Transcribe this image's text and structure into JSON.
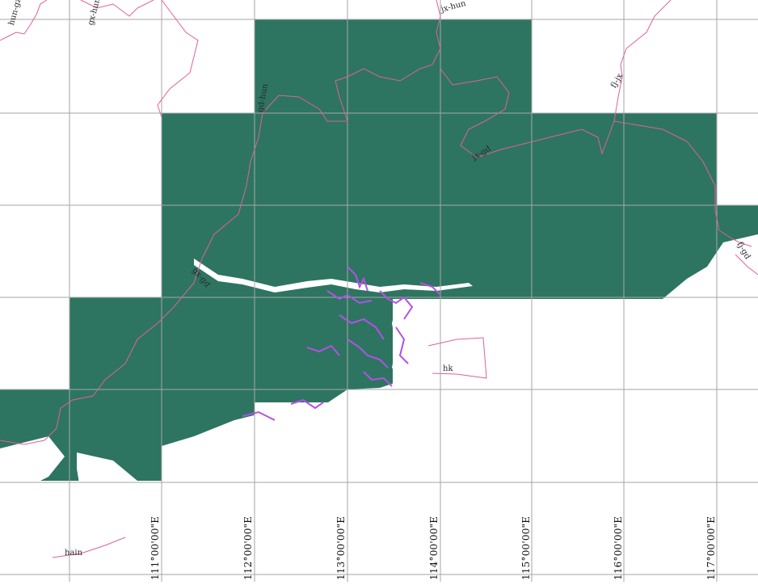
{
  "map": {
    "fill_color": "#2d7560",
    "grid_color": "#a6a6a6",
    "border_color": "#e0609a",
    "wetland_color": "#b450e6",
    "longitude_labels": [
      "111°00'00\"E",
      "112°00'00\"E",
      "113°00'00\"E",
      "114°00'00\"E",
      "115°00'00\"E",
      "116°00'00\"E",
      "117°00'00\"E"
    ],
    "border_labels": {
      "hun_gz": "hun-gz",
      "gx_hun": "gx-hun",
      "jx_hun": "jx-hun",
      "gd_hun": "gd-hun",
      "fj_jx": "fj-jx",
      "jx_gd": "jx-gd",
      "gx_gd": "gx-gd",
      "fj_gd": "fj-gd",
      "hk": "hk",
      "hain": "hain"
    }
  }
}
